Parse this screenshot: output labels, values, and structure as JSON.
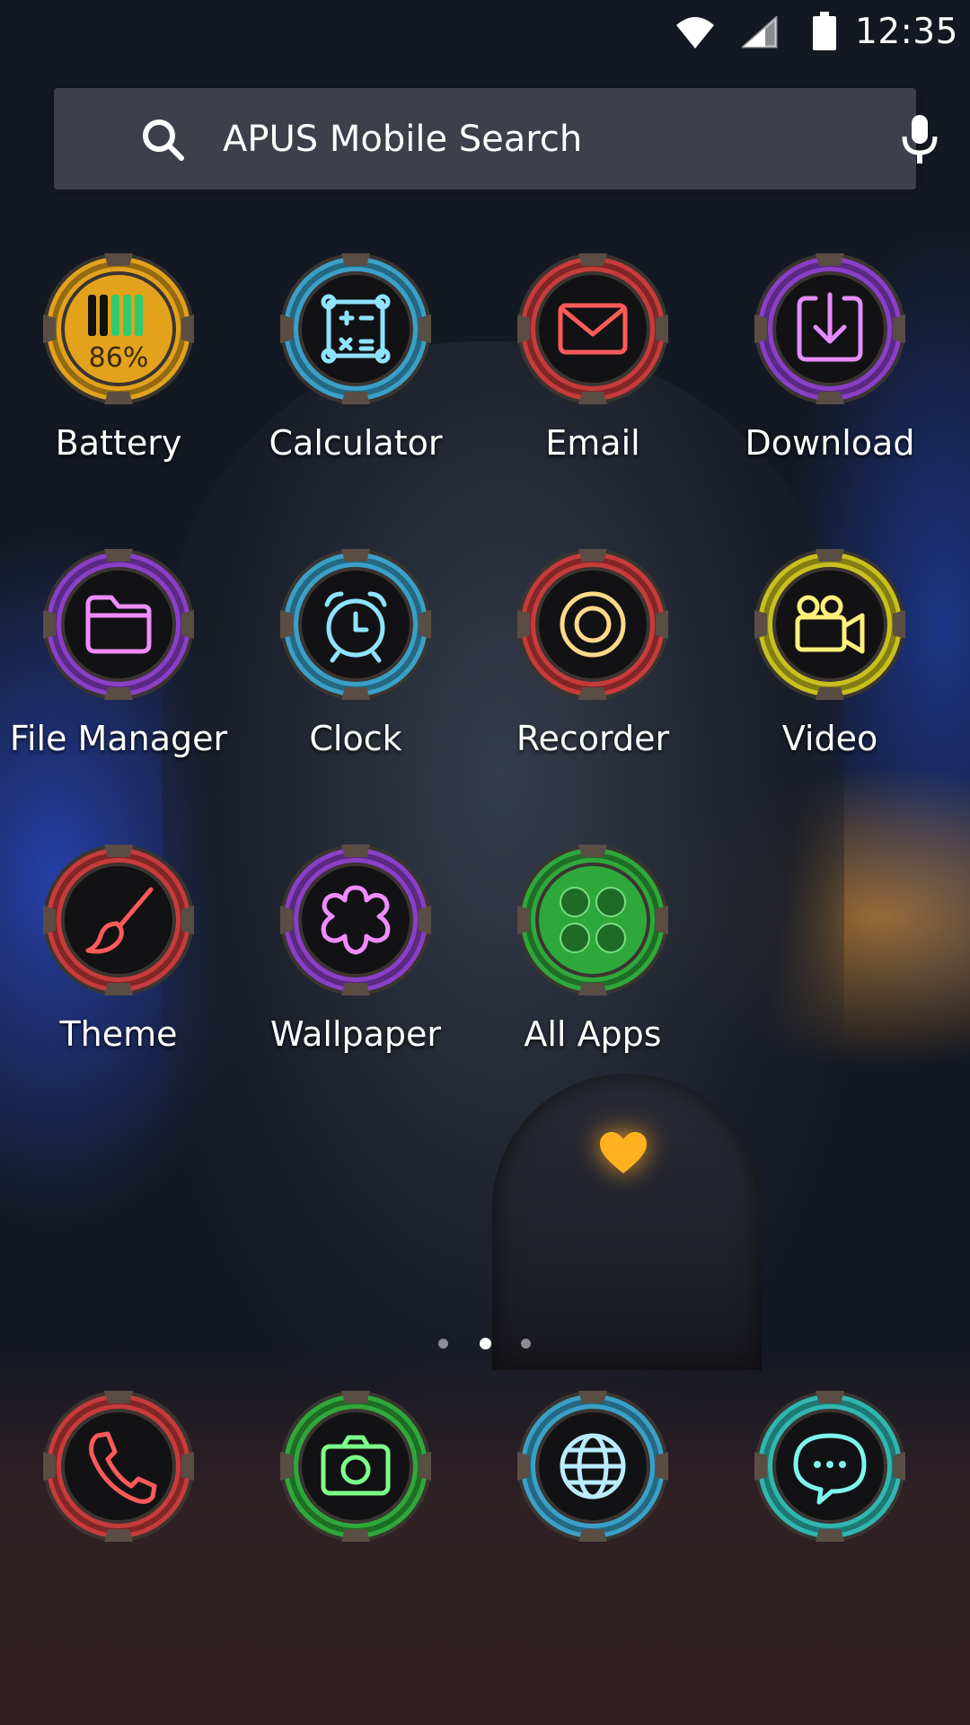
{
  "status_bar": {
    "time": "12:35"
  },
  "search": {
    "text": "APUS Mobile Search"
  },
  "apps": [
    {
      "label": "Battery",
      "icon": "battery-icon",
      "ring_color": "#e2a21c",
      "glyph_color": "#2ecc71",
      "percent": "86%"
    },
    {
      "label": "Calculator",
      "icon": "calculator-icon",
      "ring_color": "#3aa0c8",
      "glyph_color": "#8ee3ff"
    },
    {
      "label": "Email",
      "icon": "envelope-icon",
      "ring_color": "#c73b3b",
      "glyph_color": "#ff5a5a"
    },
    {
      "label": "Download",
      "icon": "download-icon",
      "ring_color": "#8a3fc8",
      "glyph_color": "#e48cff"
    },
    {
      "label": "File Manager",
      "icon": "folder-icon",
      "ring_color": "#8a3fc8",
      "glyph_color": "#f08cff"
    },
    {
      "label": "Clock",
      "icon": "alarm-clock-icon",
      "ring_color": "#3aa0c8",
      "glyph_color": "#8ee3ff"
    },
    {
      "label": "Recorder",
      "icon": "record-icon",
      "ring_color": "#c73b3b",
      "glyph_color": "#ffd98a"
    },
    {
      "label": "Video",
      "icon": "video-camera-icon",
      "ring_color": "#c8c01e",
      "glyph_color": "#fff07a"
    },
    {
      "label": "Theme",
      "icon": "paintbrush-icon",
      "ring_color": "#c73b3b",
      "glyph_color": "#ff5a5a"
    },
    {
      "label": "Wallpaper",
      "icon": "flower-icon",
      "ring_color": "#8a3fc8",
      "glyph_color": "#f08cff"
    },
    {
      "label": "All Apps",
      "icon": "app-grid-icon",
      "ring_color": "#2ea83a",
      "glyph_color": "#2ea83a"
    }
  ],
  "dock": [
    {
      "icon": "phone-icon",
      "ring_color": "#c73b3b",
      "glyph_color": "#ff5a5a"
    },
    {
      "icon": "camera-icon",
      "ring_color": "#2ea83a",
      "glyph_color": "#7dff8a"
    },
    {
      "icon": "globe-icon",
      "ring_color": "#3aa0c8",
      "glyph_color": "#b9ecff"
    },
    {
      "icon": "chat-bubble-icon",
      "ring_color": "#2fb7b0",
      "glyph_color": "#7ff5ee"
    }
  ],
  "page_indicator": {
    "pages": 3,
    "current": 2
  },
  "decor": {
    "heart_color": "#ffb21e"
  }
}
